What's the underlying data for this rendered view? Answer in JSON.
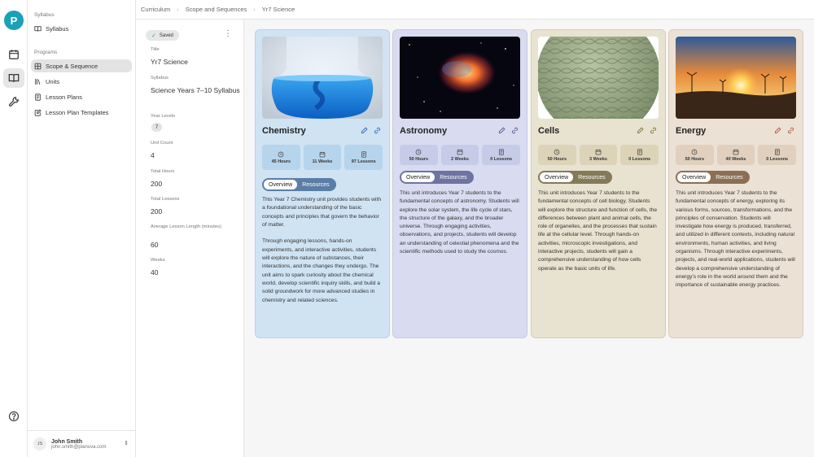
{
  "app": {
    "logo_letter": "P"
  },
  "breadcrumb": [
    "Curriculum",
    "Scope and Sequences",
    "Yr7 Science"
  ],
  "sidebar": {
    "section_syllabus": "Syllabus",
    "syllabus_item": "Syllabus",
    "section_programs": "Programs",
    "items": [
      {
        "label": "Scope & Sequence",
        "icon": "grid-icon",
        "active": true
      },
      {
        "label": "Units",
        "icon": "books-icon",
        "active": false
      },
      {
        "label": "Lesson Plans",
        "icon": "document-icon",
        "active": false
      },
      {
        "label": "Lesson Plan Templates",
        "icon": "edit-document-icon",
        "active": false
      }
    ]
  },
  "user": {
    "initials": "JS",
    "name": "John Smith",
    "email": "john.smith@planuva.com"
  },
  "detail": {
    "status": "Saved",
    "title_label": "Title",
    "title_value": "Yr7 Science",
    "syllabus_label": "Syllabus",
    "syllabus_value": "Science Years 7–10 Syllabus",
    "year_levels_label": "Year Levels",
    "year_levels_value": "7",
    "unit_count_label": "Unit Count",
    "unit_count_value": "4",
    "total_hours_label": "Total Hours",
    "total_hours_value": "200",
    "total_lessons_label": "Total Lessons",
    "total_lessons_value": "200",
    "avg_len_label": "Average Lesson Length (minutes)",
    "avg_len_value": "60",
    "weeks_label": "Weeks",
    "weeks_value": "40"
  },
  "units": [
    {
      "title": "Chemistry",
      "hours": "45 Hours",
      "weeks": "11 Weeks",
      "lessons": "97 Lessons",
      "tab_overview": "Overview",
      "tab_resources": "Resources",
      "description": "This Year 7 Chemistry unit provides students with a foundational understanding of the basic concepts and principles that govern the behavior of matter.\n\nThrough engaging lessons, hands-on experiments, and interactive activities, students will explore the nature of substances, their interactions, and the changes they undergo. The unit aims to spark curiosity about the chemical world, develop scientific inquiry skills, and build a solid groundwork for more advanced studies in chemistry and related sciences."
    },
    {
      "title": "Astronomy",
      "hours": "50 Hours",
      "weeks": "2 Weeks",
      "lessons": "0 Lessons",
      "tab_overview": "Overview",
      "tab_resources": "Resources",
      "description": "This unit introduces Year 7 students to the fundamental concepts of astronomy. Students will explore the solar system, the life cycle of stars, the structure of the galaxy, and the broader universe. Through engaging activities, observations, and projects, students will develop an understanding of celestial phenomena and the scientific methods used to study the cosmos."
    },
    {
      "title": "Cells",
      "hours": "50 Hours",
      "weeks": "3 Weeks",
      "lessons": "0 Lessons",
      "tab_overview": "Overview",
      "tab_resources": "Resources",
      "description": "This unit introduces Year 7 students to the fundamental concepts of cell biology. Students will explore the structure and function of cells, the differences between plant and animal cells, the role of organelles, and the processes that sustain life at the cellular level. Through hands-on activities, microscopic investigations, and interactive projects, students will gain a comprehensive understanding of how cells operate as the basic units of life."
    },
    {
      "title": "Energy",
      "hours": "50 Hours",
      "weeks": "40 Weeks",
      "lessons": "0 Lessons",
      "tab_overview": "Overview",
      "tab_resources": "Resources",
      "description": "This unit introduces Year 7 students to the fundamental concepts of energy, exploring its various forms, sources, transformations, and the principles of conservation. Students will investigate how energy is produced, transferred, and utilized in different contexts, including natural environments, human activities, and living organisms. Through interactive experiments, projects, and real-world applications, students will develop a comprehensive understanding of energy's role in the world around them and the importance of sustainable energy practices."
    }
  ]
}
